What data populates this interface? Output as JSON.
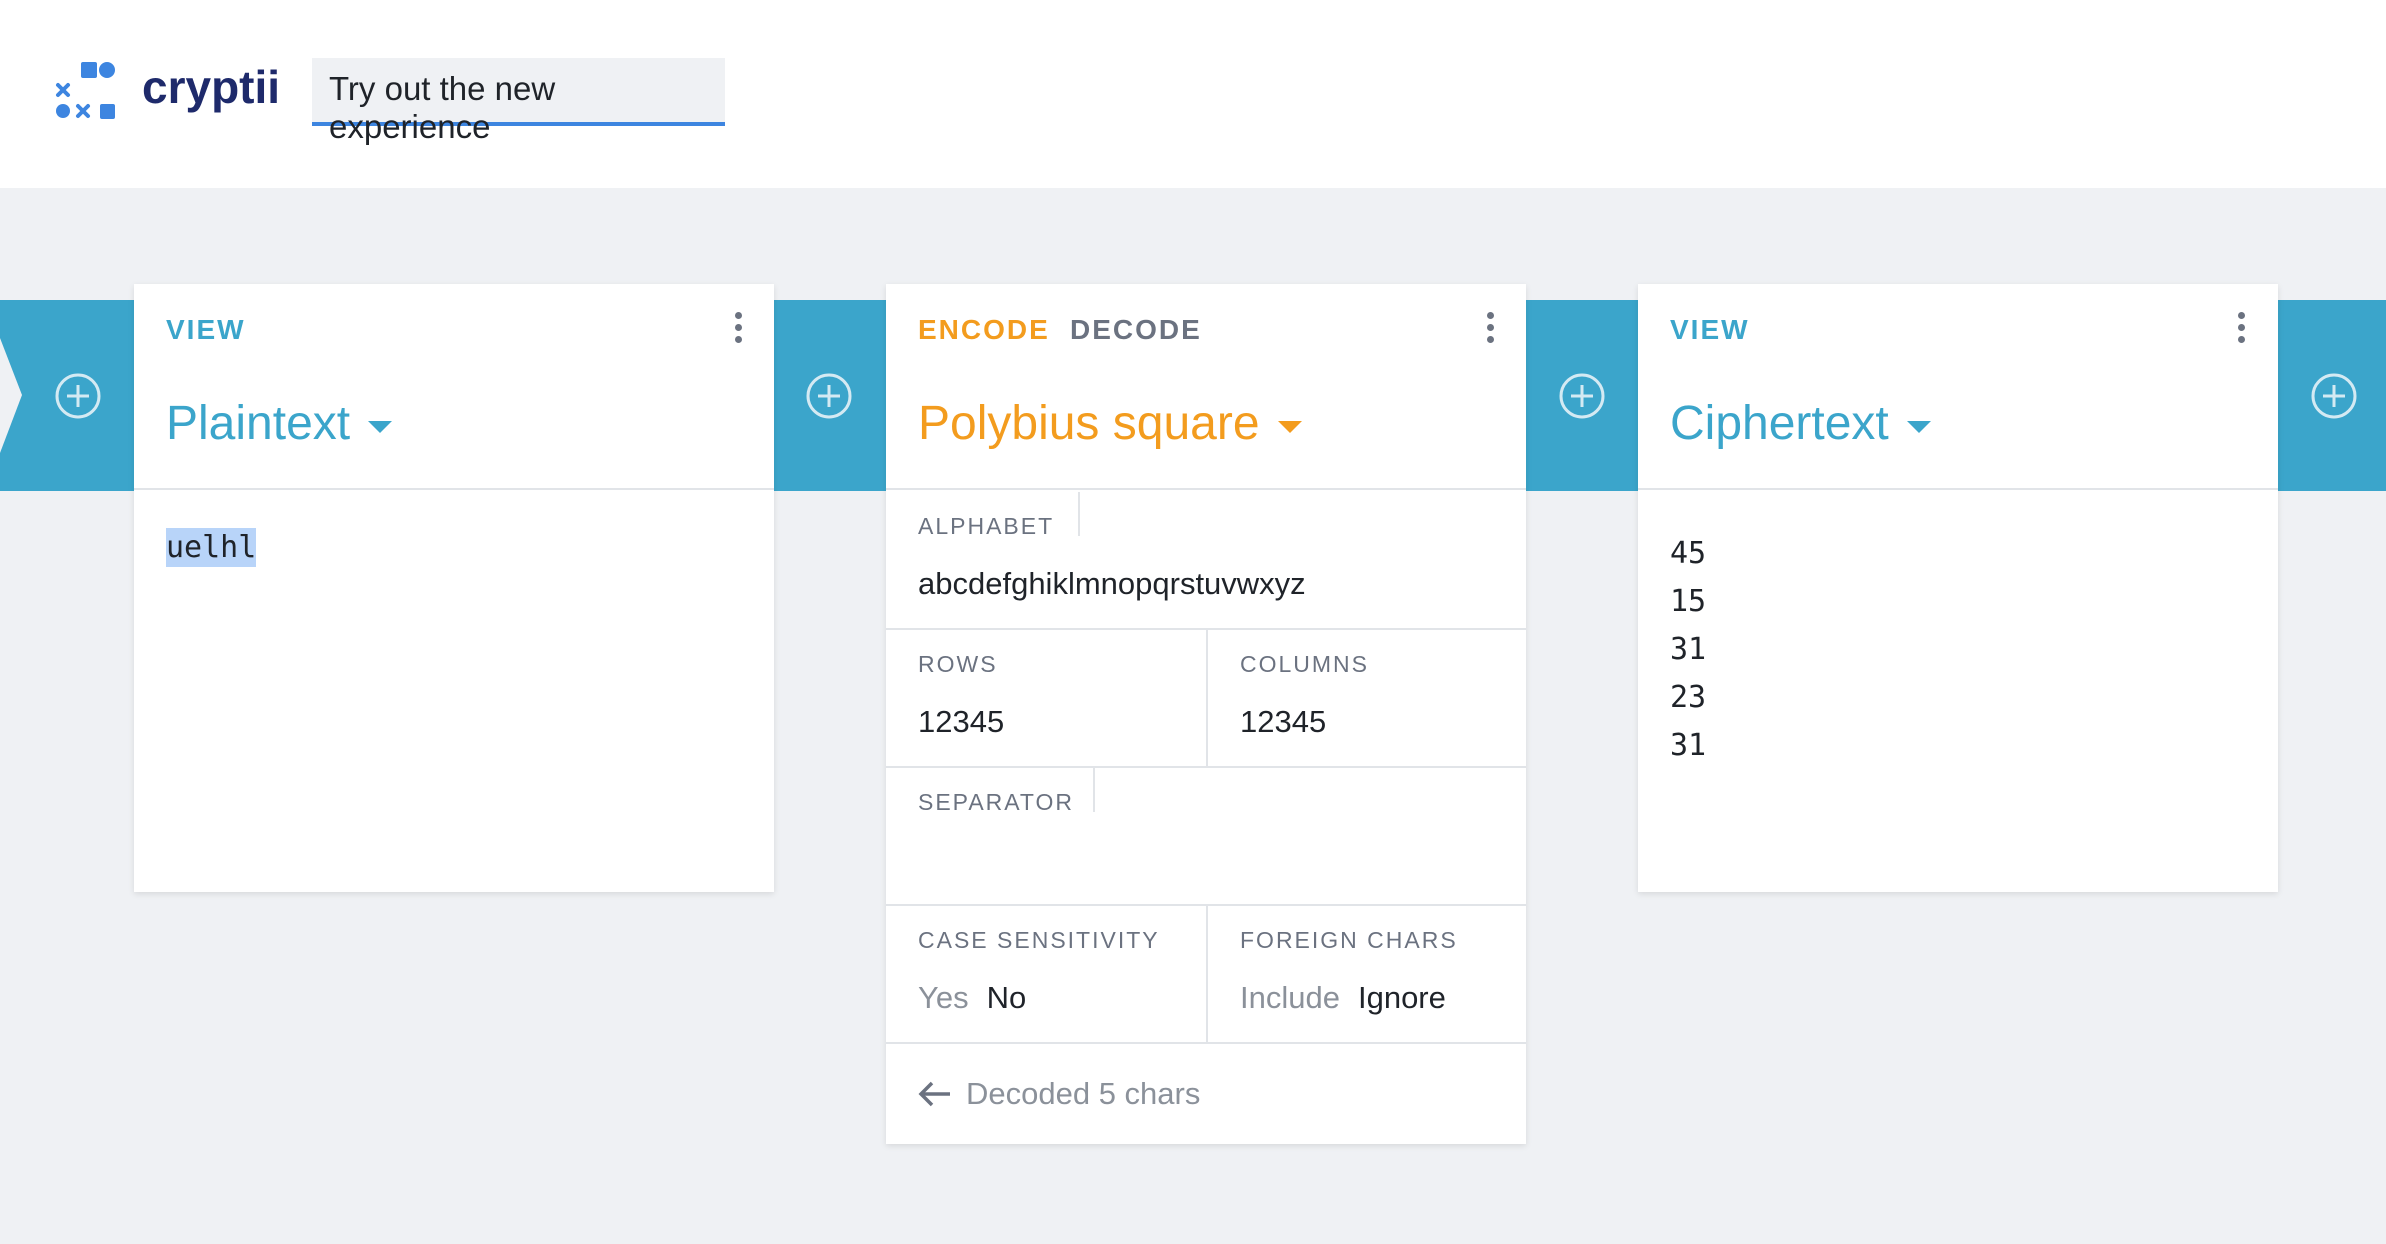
{
  "header": {
    "brand": "cryptii",
    "try_button": "Try out the new experience"
  },
  "colors": {
    "accent_blue": "#3ba5cb",
    "encoder_orange": "#f39c1e",
    "brand_navy": "#1e2a6b",
    "logo_blue": "#3d85e0"
  },
  "icons": {
    "add": "plus-circle-icon",
    "menu": "more-vertical-icon",
    "dropdown": "caret-down-icon",
    "back": "arrow-left-icon"
  },
  "plaintext_card": {
    "mode": "VIEW",
    "title": "Plaintext",
    "content": "uelhl"
  },
  "encoder_card": {
    "mode_encode": "ENCODE",
    "mode_decode": "DECODE",
    "title": "Polybius square",
    "alphabet_label": "ALPHABET",
    "alphabet_value": "abcdefghiklmnopqrstuvwxyz",
    "rows_label": "ROWS",
    "rows_value": "12345",
    "columns_label": "COLUMNS",
    "columns_value": "12345",
    "separator_label": "SEPARATOR",
    "separator_value": "",
    "case_label": "CASE SENSITIVITY",
    "case_yes": "Yes",
    "case_no": "No",
    "foreign_label": "FOREIGN CHARS",
    "foreign_include": "Include",
    "foreign_ignore": "Ignore",
    "status": "Decoded 5 chars"
  },
  "ciphertext_card": {
    "mode": "VIEW",
    "title": "Ciphertext",
    "lines": [
      "45",
      "15",
      "31",
      "23",
      "31"
    ]
  }
}
